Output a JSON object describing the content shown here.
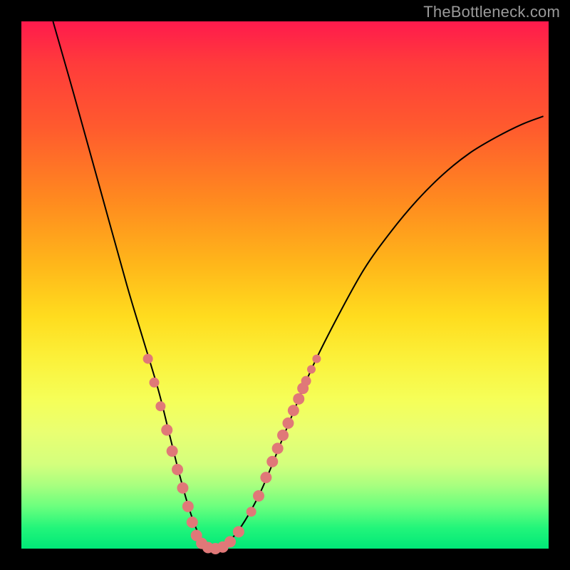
{
  "watermark": "TheBottleneck.com",
  "chart_data": {
    "type": "line",
    "title": "",
    "xlabel": "",
    "ylabel": "",
    "xlim": [
      0,
      100
    ],
    "ylim": [
      0,
      100
    ],
    "grid": false,
    "legend": false,
    "background_gradient": {
      "top": "#ff1a4d",
      "middle": "#ffe030",
      "bottom": "#00e878"
    },
    "series": [
      {
        "name": "bottleneck-curve",
        "color": "#000000",
        "stroke_width": 2,
        "x": [
          6,
          10,
          15,
          20,
          23,
          26,
          28,
          30,
          32,
          34,
          36,
          40,
          45,
          50,
          55,
          60,
          65,
          70,
          75,
          80,
          85,
          90,
          95,
          99
        ],
        "y": [
          100,
          86,
          68,
          50,
          40,
          30,
          22,
          14,
          7,
          2,
          0,
          2,
          10,
          22,
          34,
          44,
          53,
          60,
          66,
          71,
          75,
          78,
          80.5,
          82
        ]
      }
    ],
    "markers": {
      "name": "highlighted-points",
      "color": "#e07878",
      "radius_range": [
        5,
        9
      ],
      "points": [
        {
          "x": 24.0,
          "y": 36.0,
          "r": 7
        },
        {
          "x": 25.2,
          "y": 31.5,
          "r": 7
        },
        {
          "x": 26.4,
          "y": 27.0,
          "r": 7
        },
        {
          "x": 27.6,
          "y": 22.5,
          "r": 8
        },
        {
          "x": 28.6,
          "y": 18.5,
          "r": 8
        },
        {
          "x": 29.6,
          "y": 15.0,
          "r": 8
        },
        {
          "x": 30.6,
          "y": 11.5,
          "r": 8
        },
        {
          "x": 31.6,
          "y": 8.0,
          "r": 8
        },
        {
          "x": 32.4,
          "y": 5.0,
          "r": 8
        },
        {
          "x": 33.2,
          "y": 2.5,
          "r": 8
        },
        {
          "x": 34.2,
          "y": 1.0,
          "r": 8
        },
        {
          "x": 35.4,
          "y": 0.2,
          "r": 8
        },
        {
          "x": 36.8,
          "y": 0.0,
          "r": 8
        },
        {
          "x": 38.2,
          "y": 0.3,
          "r": 8
        },
        {
          "x": 39.6,
          "y": 1.3,
          "r": 8
        },
        {
          "x": 41.2,
          "y": 3.2,
          "r": 8
        },
        {
          "x": 43.6,
          "y": 7.0,
          "r": 7
        },
        {
          "x": 45.0,
          "y": 10.0,
          "r": 8
        },
        {
          "x": 46.4,
          "y": 13.5,
          "r": 8
        },
        {
          "x": 47.6,
          "y": 16.5,
          "r": 8
        },
        {
          "x": 48.6,
          "y": 19.0,
          "r": 8
        },
        {
          "x": 49.6,
          "y": 21.5,
          "r": 8
        },
        {
          "x": 50.6,
          "y": 23.8,
          "r": 8
        },
        {
          "x": 51.6,
          "y": 26.2,
          "r": 8
        },
        {
          "x": 52.6,
          "y": 28.4,
          "r": 8
        },
        {
          "x": 53.4,
          "y": 30.4,
          "r": 8
        },
        {
          "x": 54.0,
          "y": 31.8,
          "r": 7
        },
        {
          "x": 55.0,
          "y": 34.0,
          "r": 6
        },
        {
          "x": 56.0,
          "y": 36.0,
          "r": 6
        }
      ]
    }
  }
}
